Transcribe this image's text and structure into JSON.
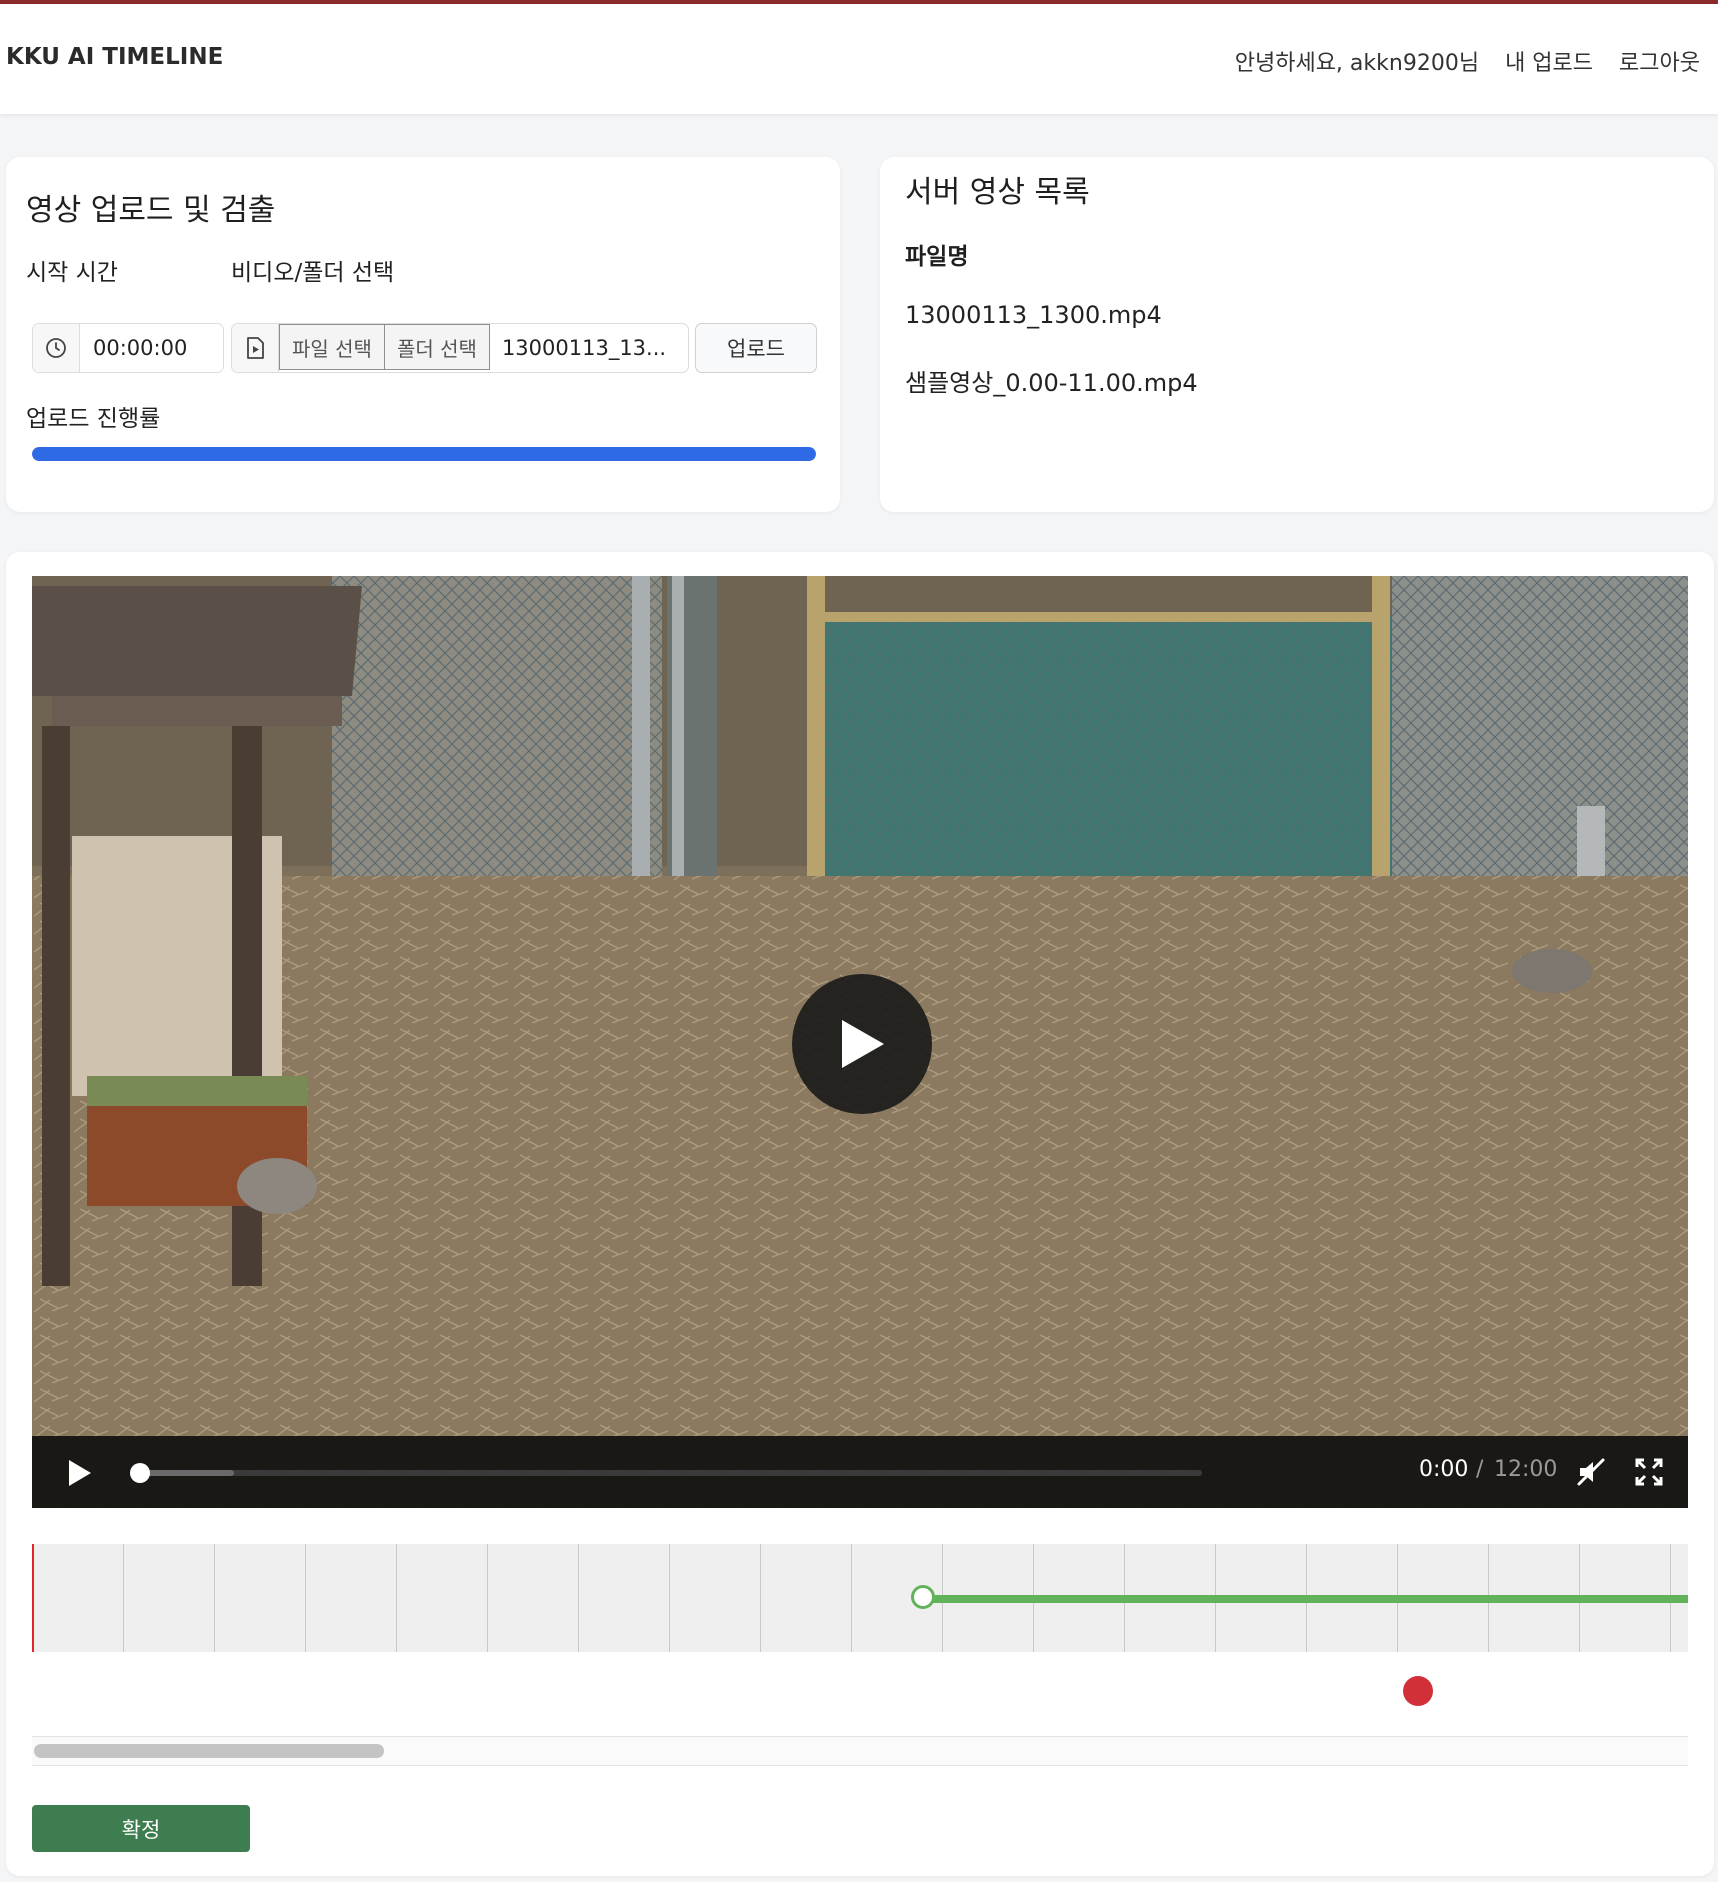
{
  "navbar": {
    "brand": "KKU AI TIMELINE",
    "greeting": "안녕하세요, akkn9200님",
    "my_uploads": "내 업로드",
    "logout": "로그아웃"
  },
  "upload_card": {
    "title": "영상 업로드 및 검출",
    "start_time_label": "시작 시간",
    "start_time_value": "00:00:00",
    "source_label": "비디오/폴더 선택",
    "file_select": "파일 선택",
    "folder_select": "폴더 선택",
    "selected_file": "13000113_13...",
    "upload_button": "업로드",
    "progress_label": "업로드 진행률",
    "progress_percent": 100
  },
  "server_list": {
    "title": "서버 영상 목록",
    "column_header": "파일명",
    "files": [
      "13000113_1300.mp4",
      "샘플영상_0.00-11.00.mp4"
    ]
  },
  "player": {
    "current_time": "0:00",
    "separator": "/",
    "total_time": "12:00"
  },
  "timeline": {
    "segment_start_fraction": 0.538,
    "segment_end_fraction": 1.0,
    "marker_fraction": 0.837
  },
  "confirm_button": "확정",
  "colors": {
    "accent_blue": "#2e6ae6",
    "segment_green": "#61b35a",
    "marker_red": "#d23038",
    "confirm_green": "#3d7d4f",
    "top_bar": "#8b2a2a"
  }
}
